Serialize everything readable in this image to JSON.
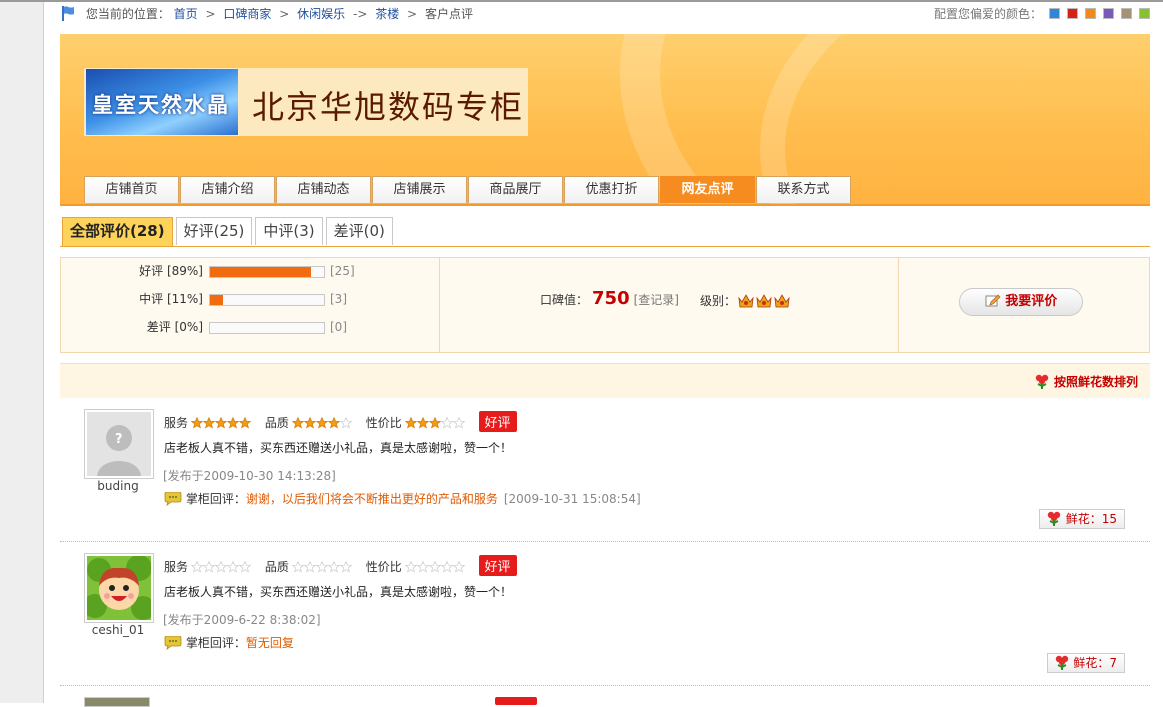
{
  "breadcrumb": {
    "prefix": "您当前的位置：",
    "items": [
      "首页",
      "口碑商家",
      "休闲娱乐",
      "茶楼",
      "客户点评"
    ],
    "seps": [
      ">",
      ">",
      "->",
      ">"
    ]
  },
  "color_picker": {
    "label": "配置您偏爱的颜色：",
    "swatches": [
      "#2e86d6",
      "#d6201a",
      "#f08a1c",
      "#7a5ab8",
      "#a39373",
      "#86c22c"
    ]
  },
  "banner": {
    "logo_text": "皇室天然水晶",
    "shop_name": "北京华旭数码专柜"
  },
  "nav": {
    "tabs": [
      "店铺首页",
      "店铺介绍",
      "店铺动态",
      "店铺展示",
      "商品展厅",
      "优惠打折",
      "网友点评",
      "联系方式"
    ],
    "active": 6
  },
  "review_tabs": [
    "全部评价(28)",
    "好评(25)",
    "中评(3)",
    "差评(0)"
  ],
  "summary": {
    "rows": [
      {
        "label": "好评",
        "pct": "[89%]",
        "fraction": 0.89,
        "count": "[25]"
      },
      {
        "label": "中评",
        "pct": "[11%]",
        "fraction": 0.11,
        "count": "[3]"
      },
      {
        "label": "差评",
        "pct": "[0%]",
        "fraction": 0.0,
        "count": "[0]"
      }
    ],
    "kb_label": "口碑值：",
    "kb_value": "750",
    "kb_record": "[查记录]",
    "level_label": "级别：",
    "level_crowns": 3,
    "rate_button": "我要评价"
  },
  "sort_label": "按照鲜花数排列",
  "reviews": [
    {
      "user": "buding",
      "avatar": "default",
      "ratings": [
        {
          "label": "服务",
          "stars": 5
        },
        {
          "label": "品质",
          "stars": 4
        },
        {
          "label": "性价比",
          "stars": 3
        }
      ],
      "badge": "好评",
      "content": "店老板人真不错，买东西还赠送小礼品，真是太感谢啦，赞一个！",
      "time": "[发布于2009-10-30 14:13:28]",
      "reply_label": "掌柜回评：",
      "reply_text": "谢谢，以后我们将会不断推出更好的产品和服务",
      "reply_time": "[2009-10-31 15:08:54]",
      "flowers": "鲜花：15"
    },
    {
      "user": "ceshi_01",
      "avatar": "cartoon",
      "ratings": [
        {
          "label": "服务",
          "stars": 0
        },
        {
          "label": "品质",
          "stars": 0
        },
        {
          "label": "性价比",
          "stars": 0
        }
      ],
      "badge": "好评",
      "content": "店老板人真不错，买东西还赠送小礼品，真是太感谢啦，赞一个！",
      "time": "[发布于2009-6-22 8:38:02]",
      "reply_label": "掌柜回评：",
      "reply_text": "暂无回复",
      "reply_time": "",
      "flowers": "鲜花：7"
    }
  ]
}
